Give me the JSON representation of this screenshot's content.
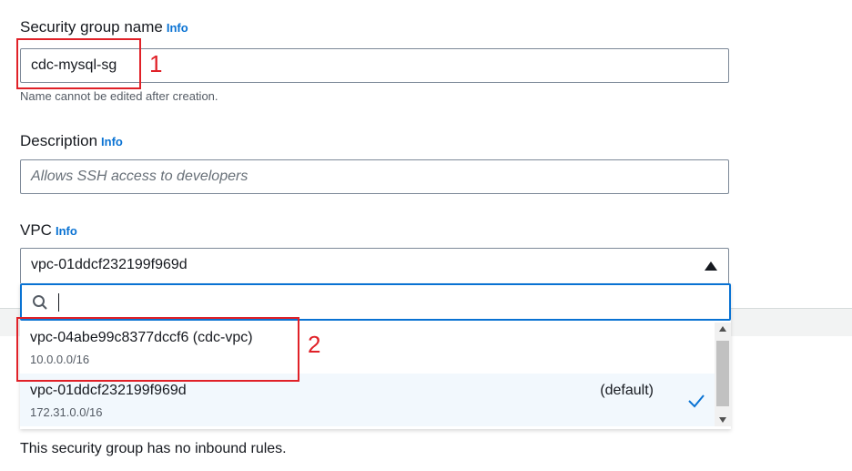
{
  "form": {
    "name_label": "Security group name",
    "name_info": "Info",
    "name_value": "cdc-mysql-sg",
    "name_hint": "Name cannot be edited after creation.",
    "desc_label": "Description",
    "desc_info": "Info",
    "desc_placeholder": "Allows SSH access to developers",
    "vpc_label": "VPC",
    "vpc_info": "Info",
    "vpc_value": "vpc-01ddcf232199f969d"
  },
  "dropdown": {
    "search_value": "",
    "options": [
      {
        "title": "vpc-04abe99c8377dccf6 (cdc-vpc)",
        "subtitle": "10.0.0.0/16",
        "tag": "",
        "selected": false
      },
      {
        "title": "vpc-01ddcf232199f969d",
        "subtitle": "172.31.0.0/16",
        "tag": "(default)",
        "selected": true
      }
    ]
  },
  "inbound": {
    "empty_text": "This security group has no inbound rules."
  },
  "annotations": {
    "num1": "1",
    "num2": "2",
    "color": "#e02128"
  },
  "colors": {
    "accent": "#0972d3",
    "selected_bg": "#f2f8fd"
  }
}
